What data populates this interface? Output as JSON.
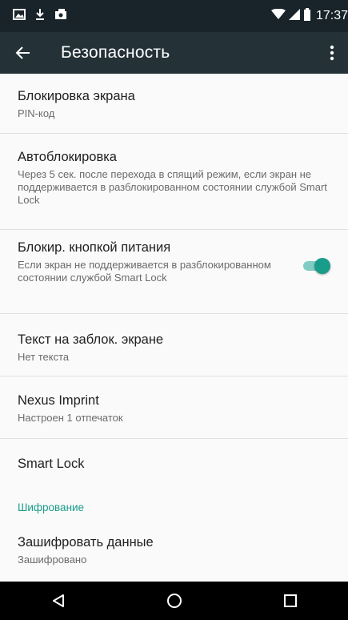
{
  "status_bar": {
    "time": "17:37",
    "icons": [
      "gallery-icon",
      "download-icon",
      "photo-icon",
      "wifi-icon",
      "signal-icon",
      "battery-icon"
    ]
  },
  "toolbar": {
    "title": "Безопасность",
    "back_icon": "back-arrow-icon",
    "menu_icon": "more-vert-icon",
    "background": "#243238"
  },
  "settings": [
    {
      "title": "Блокировка экрана",
      "subtitle": "PIN-код"
    },
    {
      "title": "Автоблокировка",
      "subtitle": "Через 5 сек. после перехода в спящий режим, если экран не поддерживается в разблокированном состоянии службой Smart Lock"
    },
    {
      "title": "Блокир. кнопкой питания",
      "subtitle": "Если экран не поддерживается в разблокированном состоянии службой Smart Lock",
      "toggle": true
    },
    {
      "title": "Текст на заблок. экране",
      "subtitle": "Нет текста"
    },
    {
      "title": "Nexus Imprint",
      "subtitle": "Настроен 1 отпечаток"
    },
    {
      "title": "Smart Lock"
    }
  ],
  "encryption": {
    "header": "Шифрование",
    "title": "Зашифровать данные",
    "subtitle": "Зашифровано"
  },
  "accent_color": "#1a9c8a",
  "nav_bar": {
    "icons": [
      "back-triangle-icon",
      "home-circle-icon",
      "recents-square-icon"
    ]
  }
}
